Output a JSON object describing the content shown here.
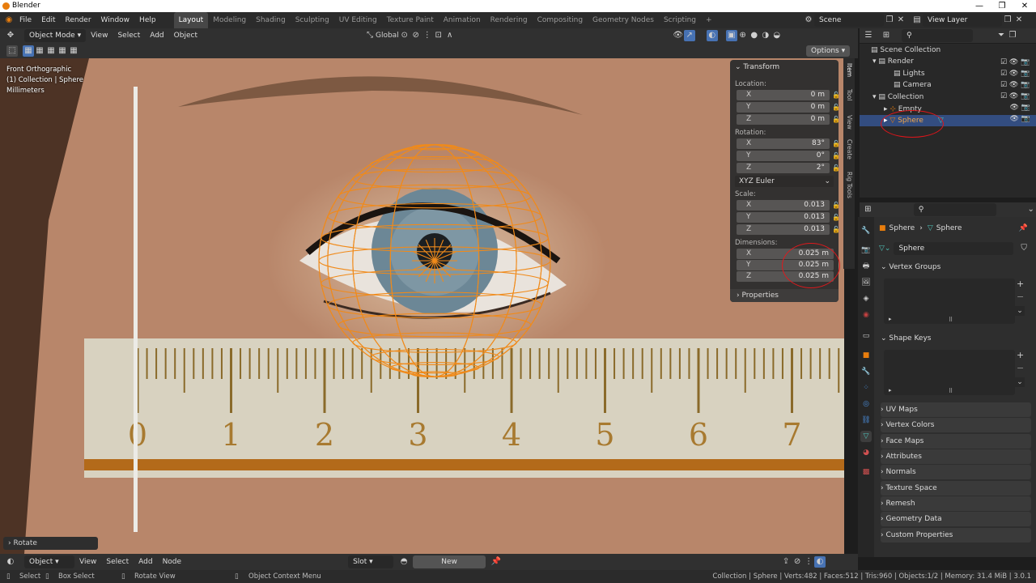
{
  "window": {
    "title": "Blender",
    "controls": [
      "—",
      "❐",
      "✕"
    ]
  },
  "menu": {
    "items": [
      "File",
      "Edit",
      "Render",
      "Window",
      "Help"
    ]
  },
  "workspaces": {
    "tabs": [
      "Layout",
      "Modeling",
      "Shading",
      "Sculpting",
      "UV Editing",
      "Texture Paint",
      "Animation",
      "Rendering",
      "Compositing",
      "Geometry Nodes",
      "Scripting"
    ],
    "active": "Layout",
    "add": "+"
  },
  "scene": {
    "name": "Scene",
    "view_layer": "View Layer"
  },
  "viewport_header": {
    "mode": "Object Mode",
    "menus": [
      "View",
      "Select",
      "Add",
      "Object"
    ],
    "orientation": "Global",
    "options": "Options"
  },
  "overlay_text": {
    "view": "Front Orthographic",
    "collection": "(1) Collection | Sphere",
    "units": "Millimeters"
  },
  "ruler_numbers": [
    "0",
    "1",
    "2",
    "3",
    "4",
    "5",
    "6",
    "7"
  ],
  "transform": {
    "title": "Transform",
    "location": {
      "label": "Location:",
      "x": "0 m",
      "y": "0 m",
      "z": "0 m"
    },
    "rotation": {
      "label": "Rotation:",
      "x": "83°",
      "y": "0°",
      "z": "2°"
    },
    "rotation_mode": "XYZ Euler",
    "scale": {
      "label": "Scale:",
      "x": "0.013",
      "y": "0.013",
      "z": "0.013"
    },
    "dimensions": {
      "label": "Dimensions:",
      "x": "0.025 m",
      "y": "0.025 m",
      "z": "0.025 m"
    },
    "axes": [
      "X",
      "Y",
      "Z"
    ],
    "properties": "Properties"
  },
  "sidebar_tabs": [
    "Item",
    "Tool",
    "View",
    "Create",
    "Rig Tools"
  ],
  "outliner": {
    "rows": [
      {
        "label": "Scene Collection",
        "indent": 0
      },
      {
        "label": "Render",
        "indent": 1
      },
      {
        "label": "Lights",
        "indent": 2
      },
      {
        "label": "Camera",
        "indent": 2
      },
      {
        "label": "Collection",
        "indent": 1
      },
      {
        "label": "Empty",
        "indent": 2
      },
      {
        "label": "Sphere",
        "indent": 2,
        "selected": true
      }
    ]
  },
  "properties": {
    "breadcrumb": {
      "object": "Sphere",
      "data": "Sphere"
    },
    "datablock": "Sphere",
    "sections": [
      "Vertex Groups",
      "Shape Keys",
      "UV Maps",
      "Vertex Colors",
      "Face Maps",
      "Attributes",
      "Normals",
      "Texture Space",
      "Remesh",
      "Geometry Data",
      "Custom Properties"
    ]
  },
  "operator_panel": "Rotate",
  "bottom_header": {
    "mode": "Object",
    "menus": [
      "View",
      "Select",
      "Add",
      "Node"
    ],
    "slot": "Slot",
    "new": "New"
  },
  "statusbar": {
    "select": "Select",
    "box_select": "Box Select",
    "rotate_view": "Rotate View",
    "context_menu": "Object Context Menu",
    "stats": "Collection | Sphere | Verts:482 | Faces:512 | Tris:960 | Objects:1/2 | Memory: 31.4 MiB | 3.0.1"
  },
  "colors": {
    "accent": "#e87d0d",
    "selection": "#334d80",
    "highlight_circle": "#e0151a",
    "wireframe": "#f08a1a"
  }
}
